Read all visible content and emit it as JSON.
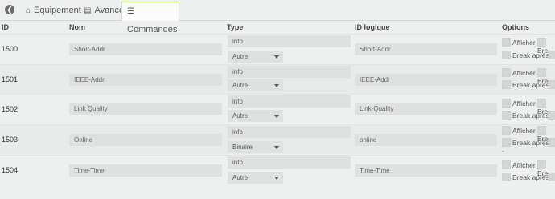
{
  "tabs": [
    {
      "label": "Equipement",
      "icon": "home-icon"
    },
    {
      "label": "Avancé",
      "icon": "list-icon"
    },
    {
      "label": "Commandes",
      "icon": "lines-icon",
      "active": true
    }
  ],
  "header": {
    "id": "ID",
    "nom": "Nom",
    "type": "Type",
    "idlogique": "ID logique",
    "options": "Options"
  },
  "rows": [
    {
      "id": "1500",
      "nom": "Short-Addr",
      "type": "info",
      "subtype": "Autre",
      "logical": "Short-Addr"
    },
    {
      "id": "1501",
      "nom": "IEEE-Addr",
      "type": "info",
      "subtype": "Autre",
      "logical": "IEEE-Addr"
    },
    {
      "id": "1502",
      "nom": "Link Quality",
      "type": "info",
      "subtype": "Autre",
      "logical": "Link-Quality"
    },
    {
      "id": "1503",
      "nom": "Online",
      "type": "info",
      "subtype": "Binaire",
      "logical": "online"
    },
    {
      "id": "1504",
      "nom": "Time-Time",
      "type": "info",
      "subtype": "Autre",
      "logical": "Time-Time"
    }
  ],
  "options": {
    "afficher": "Afficher",
    "bre": "Bre",
    "break_apres": "Break après"
  },
  "misc": {
    "dash": "-"
  }
}
